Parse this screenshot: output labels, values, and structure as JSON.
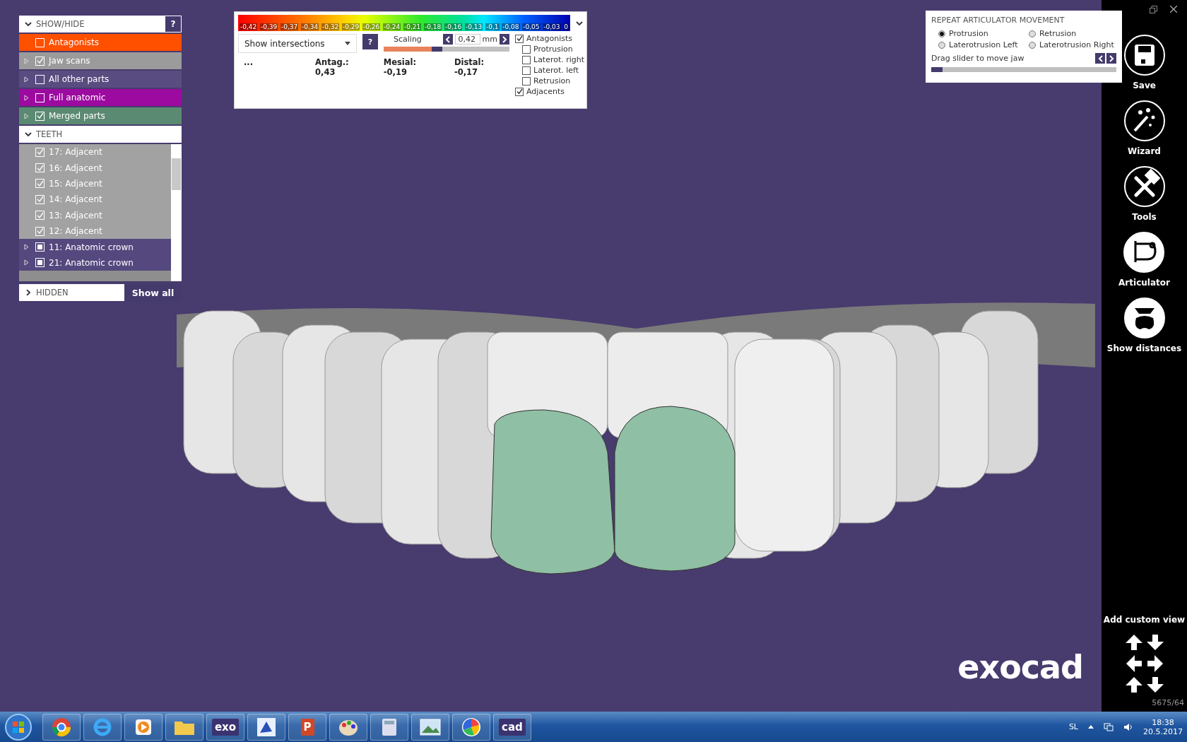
{
  "show_hide": {
    "title": "SHOW/HIDE",
    "expanded": true,
    "help": "?",
    "groups": [
      {
        "label": "Antagonists",
        "checked": false,
        "expandable": false,
        "color": "#ff5000"
      },
      {
        "label": "Jaw scans",
        "checked": true,
        "expandable": true,
        "color": "#9b9b9b"
      },
      {
        "label": "All other parts",
        "checked": false,
        "expandable": true,
        "color": "#584c80"
      },
      {
        "label": "Full anatomic",
        "checked": false,
        "expandable": true,
        "color": "#9c0aa0"
      },
      {
        "label": "Merged parts",
        "checked": true,
        "expandable": true,
        "color": "#5b8a72"
      }
    ]
  },
  "teeth": {
    "title": "TEETH",
    "expanded": true,
    "items": [
      {
        "label": "17: Adjacent",
        "checked": true,
        "partial": false,
        "expandable": false,
        "color": "#a2a2a2"
      },
      {
        "label": "16: Adjacent",
        "checked": true,
        "partial": false,
        "expandable": false,
        "color": "#a2a2a2"
      },
      {
        "label": "15: Adjacent",
        "checked": true,
        "partial": false,
        "expandable": false,
        "color": "#a2a2a2"
      },
      {
        "label": "14: Adjacent",
        "checked": true,
        "partial": false,
        "expandable": false,
        "color": "#a2a2a2"
      },
      {
        "label": "13: Adjacent",
        "checked": true,
        "partial": false,
        "expandable": false,
        "color": "#a2a2a2"
      },
      {
        "label": "12: Adjacent",
        "checked": true,
        "partial": false,
        "expandable": false,
        "color": "#a2a2a2"
      },
      {
        "label": "11: Anatomic crown",
        "checked": false,
        "partial": true,
        "expandable": true,
        "color": "#54487e"
      },
      {
        "label": "21: Anatomic crown",
        "checked": false,
        "partial": true,
        "expandable": true,
        "color": "#54487e"
      }
    ]
  },
  "hidden": {
    "title": "HIDDEN",
    "expanded": false,
    "button": "Show all"
  },
  "distance_panel": {
    "scale_labels": [
      "-0,42",
      "-0,39",
      "-0,37",
      "-0,34",
      "-0,32",
      "-0,29",
      "-0,26",
      "-0,24",
      "-0,21",
      "-0,18",
      "-0,16",
      "-0,13",
      "-0,1",
      "-0,08",
      "-0,05",
      "-0,03",
      "0"
    ],
    "mode": "Show intersections",
    "help": "?",
    "scaling_label": "Scaling",
    "scaling_value": "0,42",
    "unit": "mm",
    "level": 0.42,
    "readings": [
      "...",
      "Antag.: 0,43",
      "Mesial: -0,19",
      "Distal: -0,17"
    ],
    "options": [
      {
        "label": "Antagonists",
        "checked": true,
        "children": [
          {
            "label": "Protrusion",
            "checked": false
          },
          {
            "label": "Laterot. right",
            "checked": false
          },
          {
            "label": "Laterot. left",
            "checked": false
          },
          {
            "label": "Retrusion",
            "checked": false
          }
        ]
      },
      {
        "label": "Adjacents",
        "checked": true
      }
    ]
  },
  "articulator": {
    "title": "REPEAT ARTICULATOR MOVEMENT",
    "options": [
      {
        "label": "Protrusion",
        "selected": true
      },
      {
        "label": "Retrusion",
        "selected": false
      },
      {
        "label": "Laterotrusion Left",
        "selected": false
      },
      {
        "label": "Laterotrusion Right",
        "selected": false
      }
    ],
    "hint": "Drag slider to move jaw",
    "level": 0.06
  },
  "toolbar": [
    {
      "label": "Save",
      "kind": "save"
    },
    {
      "label": "Wizard",
      "kind": "wizard"
    },
    {
      "label": "Tools",
      "kind": "tools"
    },
    {
      "label": "Articulator",
      "kind": "articulator"
    },
    {
      "label": "Show distances",
      "kind": "distances"
    }
  ],
  "custom_view": "Add custom view",
  "counter": "5675/64",
  "logo": "exocad",
  "taskbar": {
    "apps": [
      {
        "kind": "chrome"
      },
      {
        "kind": "ie"
      },
      {
        "kind": "media"
      },
      {
        "kind": "folder"
      },
      {
        "kind": "text",
        "label": "exo"
      },
      {
        "kind": "paint"
      },
      {
        "kind": "text",
        "label": "P",
        "color": "#d24726"
      },
      {
        "kind": "palette"
      },
      {
        "kind": "calculator"
      },
      {
        "kind": "photo"
      },
      {
        "kind": "picasa"
      },
      {
        "kind": "text",
        "label": "cad"
      }
    ],
    "language": "SL",
    "time": "18:38",
    "date": "20.5.2017"
  }
}
